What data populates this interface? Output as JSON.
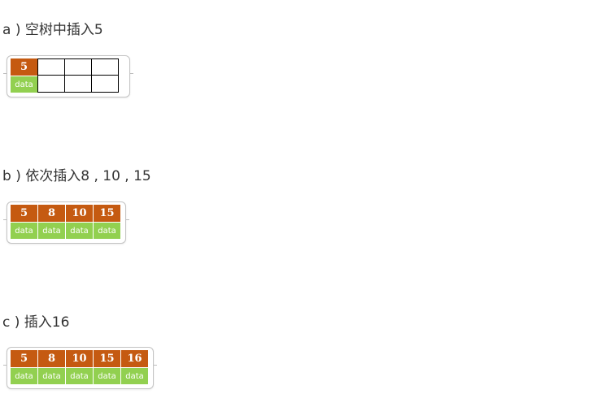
{
  "steps": [
    {
      "caption": "a ) 空树中插入5",
      "keys": [
        "5"
      ],
      "values": [
        "data"
      ],
      "empty_slots": 3
    },
    {
      "caption": "b ) 依次插入8 , 10 , 15",
      "keys": [
        "5",
        "8",
        "10",
        "15"
      ],
      "values": [
        "data",
        "data",
        "data",
        "data"
      ],
      "empty_slots": 0
    },
    {
      "caption": "c ) 插入16",
      "keys": [
        "5",
        "8",
        "10",
        "15",
        "16"
      ],
      "values": [
        "data",
        "data",
        "data",
        "data",
        "data"
      ],
      "empty_slots": 0
    }
  ],
  "colors": {
    "key_fill": "#c55a11",
    "value_fill": "#92d050",
    "text": "#333333",
    "node_border": "#c4c4c4"
  }
}
